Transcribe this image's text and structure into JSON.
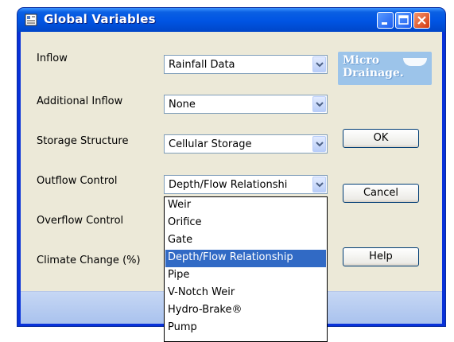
{
  "window": {
    "title": "Global Variables",
    "buttons": {
      "minimize": "minimize",
      "maximize": "maximize",
      "close": "close"
    }
  },
  "form": {
    "fields": [
      {
        "label": "Inflow",
        "value": "Rainfall Data"
      },
      {
        "label": "Additional Inflow",
        "value": "None"
      },
      {
        "label": "Storage Structure",
        "value": "Cellular Storage"
      },
      {
        "label": "Outflow Control",
        "value": "Depth/Flow Relationshi"
      },
      {
        "label": "Overflow Control"
      },
      {
        "label": "Climate Change (%)"
      }
    ]
  },
  "buttons": {
    "ok": "OK",
    "cancel": "Cancel",
    "help": "Help"
  },
  "logo": {
    "line1": "Micro",
    "line2": "Drainage."
  },
  "dropdown": {
    "items": [
      "Weir",
      "Orifice",
      "Gate",
      "Depth/Flow Relationship",
      "Pipe",
      "V-Notch Weir",
      "Hydro-Brake®",
      "Pump"
    ],
    "selected": "Depth/Flow Relationship"
  },
  "colors": {
    "titlebar": "#0054e3",
    "selection": "#316ac5",
    "client": "#ece9d8"
  }
}
